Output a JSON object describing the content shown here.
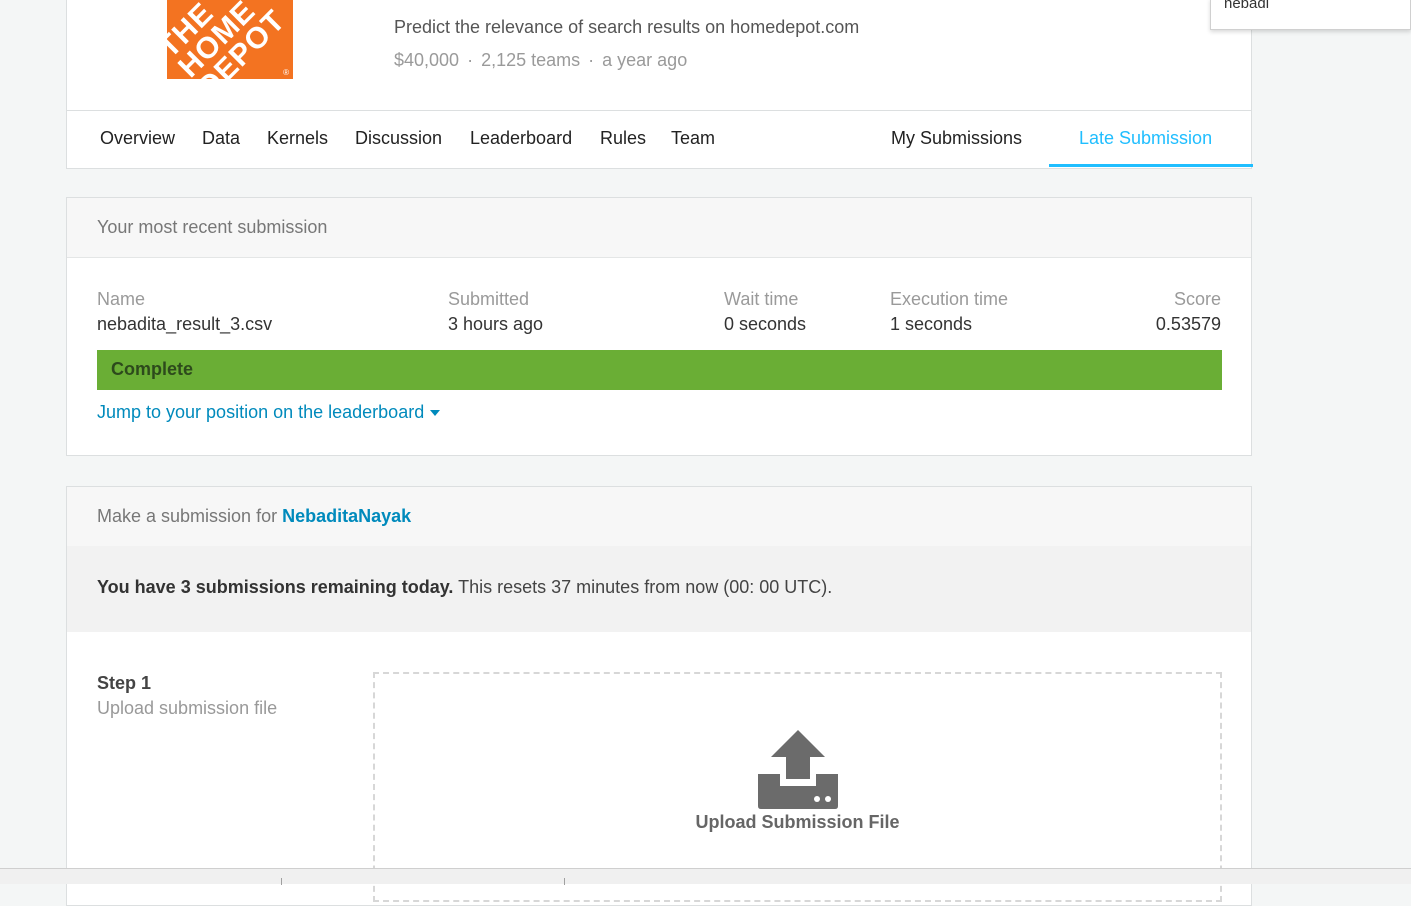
{
  "competition": {
    "logo_text": "THE\nHOME\nDEPOT",
    "subtitle": "Predict the relevance of search results on homedepot.com",
    "prize": "$40,000",
    "teams": "2,125 teams",
    "age": "a year ago"
  },
  "tabs": {
    "overview": "Overview",
    "data": "Data",
    "kernels": "Kernels",
    "discussion": "Discussion",
    "leaderboard": "Leaderboard",
    "rules": "Rules",
    "team": "Team",
    "my_submissions": "My Submissions",
    "late_submission": "Late Submission"
  },
  "recent": {
    "heading": "Your most recent submission",
    "name_label": "Name",
    "name_value": "nebadita_result_3.csv",
    "submitted_label": "Submitted",
    "submitted_value": "3 hours ago",
    "wait_label": "Wait time",
    "wait_value": "0 seconds",
    "exec_label": "Execution time",
    "exec_value": "1 seconds",
    "score_label": "Score",
    "score_value": "0.53579",
    "status": "Complete",
    "jump_link": "Jump to your position on the leaderboard"
  },
  "make": {
    "heading_prefix": "Make a submission for",
    "user": "NebaditaNayak",
    "quota_bold": "You have 3 submissions remaining today.",
    "quota_rest": "This resets 37 minutes from now (00: 00 UTC).",
    "step_title": "Step 1",
    "step_sub": "Upload submission file",
    "upload_label": "Upload Submission File"
  },
  "search_popup": {
    "text": "nebadi"
  },
  "colors": {
    "accent": "#20beff",
    "link": "#008abc",
    "complete": "#6aae35",
    "brand": "#f37321"
  }
}
